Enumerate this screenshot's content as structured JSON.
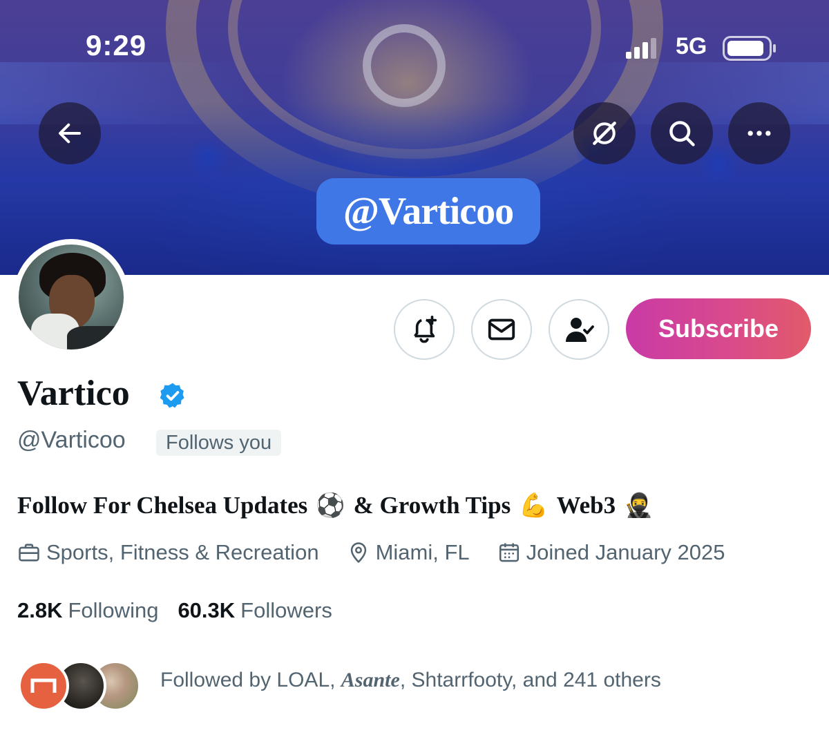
{
  "status_bar": {
    "time": "9:29",
    "network": "5G"
  },
  "banner": {
    "handle_text": "@Varticoo"
  },
  "header_actions": {
    "back_icon": "arrow-left-icon",
    "grok_icon": "grok-icon",
    "search_icon": "search-icon",
    "more_icon": "more-horizontal-icon"
  },
  "actions": {
    "notify_icon": "bell-plus-icon",
    "message_icon": "envelope-icon",
    "following_icon": "person-check-icon",
    "subscribe_label": "Subscribe"
  },
  "profile": {
    "display_name": "Vartico",
    "handle": "@Varticoo",
    "follows_you": "Follows you",
    "bio_part1": "Follow For Chelsea Updates",
    "bio_emoji1": "⚽",
    "bio_part2": "& Growth Tips",
    "bio_emoji2": "💪",
    "bio_part3": "Web3",
    "bio_emoji3": "🥷",
    "category": "Sports, Fitness & Recreation",
    "location": "Miami, FL",
    "joined": "Joined January 2025"
  },
  "stats": {
    "following_count": "2.8K",
    "following_label": "Following",
    "followers_count": "60.3K",
    "followers_label": "Followers"
  },
  "followed_by": {
    "prefix": "Followed by LOAL, ",
    "highlight": "Asante",
    "suffix": ", Shtarrfooty, and 241 others"
  },
  "colors": {
    "accent_blue": "#1d9bf0",
    "subscribe_gradient_start": "#c93aa6",
    "subscribe_gradient_end": "#e25a6a",
    "muted_text": "#536471",
    "banner_handle_bg": "#3f78e6"
  }
}
